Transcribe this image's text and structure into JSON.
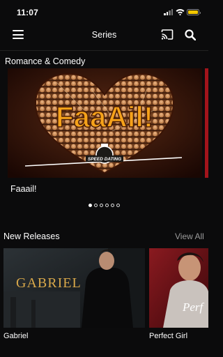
{
  "status": {
    "time": "11:07"
  },
  "header": {
    "title": "Series"
  },
  "sections": {
    "romance": {
      "title": "Romance & Comedy",
      "featured": {
        "caption": "Faaail!",
        "artwork_text": "FaaAil!",
        "badge_text": "SPEED DATING"
      },
      "carousel": {
        "total": 6,
        "active": 1
      }
    },
    "new_releases": {
      "title": "New Releases",
      "view_all": "View All",
      "items": [
        {
          "label": "Gabriel",
          "artwork_text": "GABRIEL"
        },
        {
          "label": "Perfect Girl",
          "artwork_text": "Perf"
        }
      ]
    }
  },
  "colors": {
    "background": "#0b0b0c",
    "accent_battery": "#f4c800",
    "muted_text": "#9b9b9b",
    "hero_orange": "#f5a21a"
  }
}
